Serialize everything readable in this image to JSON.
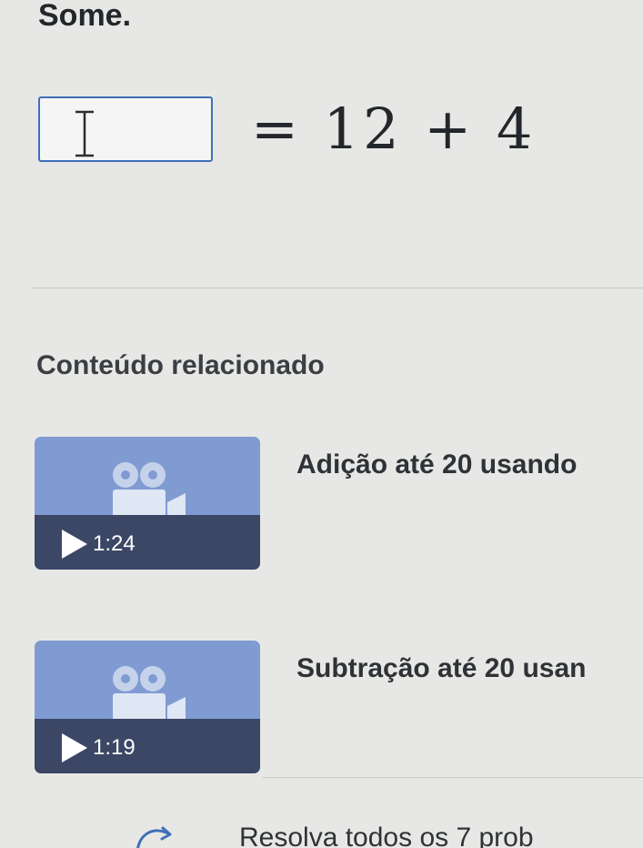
{
  "exercise": {
    "instruction": "Some.",
    "expression": "= 12 + 4",
    "answer_value": ""
  },
  "related": {
    "title": "Conteúdo relacionado",
    "videos": [
      {
        "title": "Adição até 20 usando",
        "duration": "1:24"
      },
      {
        "title": "Subtração até 20 usan",
        "duration": "1:19"
      }
    ]
  },
  "task": {
    "text": "Resolva todos os 7 prob"
  },
  "colors": {
    "accent": "#3f6fb8",
    "thumbnail": "#7f9bd2",
    "thumbnail_bar": "#3c4766"
  }
}
